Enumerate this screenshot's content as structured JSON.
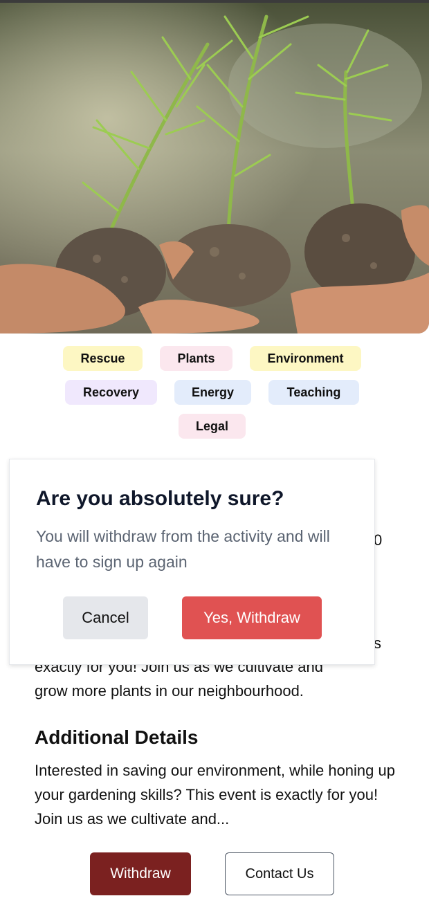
{
  "hero": {
    "image": "seedlings-in-hands-photo"
  },
  "tags": [
    {
      "label": "Rescue",
      "color": "#fdf7c3"
    },
    {
      "label": "Plants",
      "color": "#fbe7ee"
    },
    {
      "label": "Environment",
      "color": "#fdf7c3"
    },
    {
      "label": "Recovery",
      "color": "#f0e8fd"
    },
    {
      "label": "Energy",
      "color": "#e3ecfb"
    },
    {
      "label": "Teaching",
      "color": "#e3ecfb"
    },
    {
      "label": "Legal",
      "color": "#fbe7ee"
    }
  ],
  "background": {
    "partial_right_char_1": "0",
    "partial_right_char_2": "s",
    "partial_line": "exactly for you! Join us as we cultivate and",
    "line_after": "grow more plants in our neighbourhood."
  },
  "additional": {
    "title": "Additional Details",
    "body": "Interested in saving our environment, while honing up your gardening skills? This event is exactly for you! Join us as we cultivate and..."
  },
  "dialog": {
    "title": "Are you absolutely sure?",
    "description": "You will withdraw from the activity and will have to sign up again",
    "cancel_label": "Cancel",
    "confirm_label": "Yes, Withdraw"
  },
  "actions": {
    "withdraw_label": "Withdraw",
    "contact_label": "Contact Us"
  },
  "colors": {
    "withdraw": "#7b2120",
    "confirm": "#e05252"
  }
}
